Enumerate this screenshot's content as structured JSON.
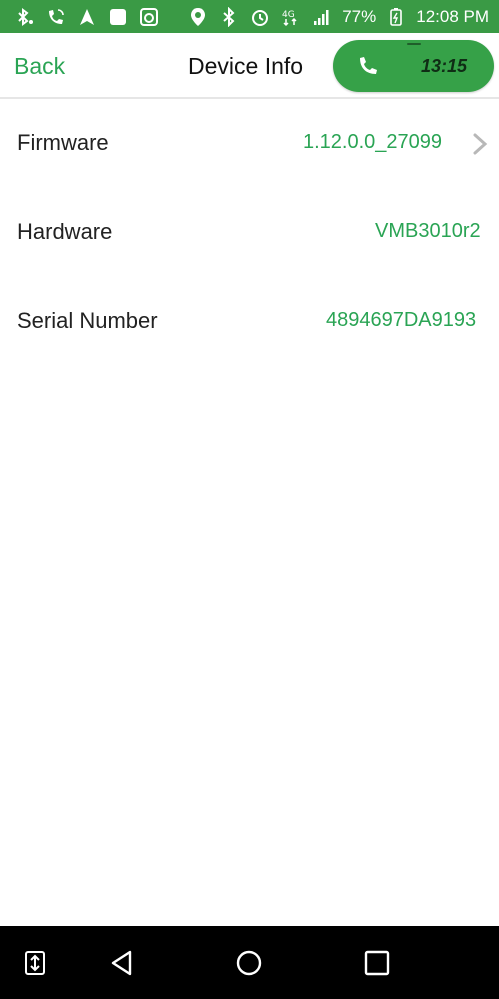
{
  "status_bar": {
    "battery": "77%",
    "time": "12:08 PM",
    "network": "4G",
    "left_icons": [
      "bluetooth-headset-icon",
      "wifi-calling-icon",
      "navigation-icon",
      "app-icon",
      "camera-app-icon"
    ],
    "right_icons": [
      "location-icon",
      "bluetooth-icon",
      "alarm-icon",
      "lte-icon",
      "signal-icon",
      "battery-icon"
    ]
  },
  "header": {
    "back_label": "Back",
    "title": "Device Info",
    "call_time": "13:15"
  },
  "rows": [
    {
      "label": "Firmware",
      "value": "1.12.0.0_27099",
      "has_chevron": true
    },
    {
      "label": "Hardware",
      "value": "VMB3010r2",
      "has_chevron": false
    },
    {
      "label": "Serial Number",
      "value": "4894697DA9193",
      "has_chevron": false
    }
  ],
  "nav_bar": {
    "icons": [
      "recent-apps-switch-icon",
      "back-icon",
      "home-icon",
      "overview-icon"
    ]
  },
  "colors": {
    "status_bar": "#3a9a45",
    "accent_green": "#2aa454",
    "call_pill": "#36a148",
    "nav_bar": "#000000"
  }
}
